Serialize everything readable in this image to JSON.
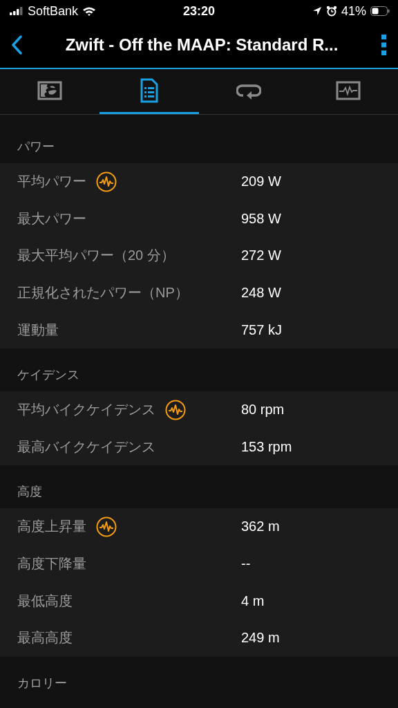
{
  "status_bar": {
    "carrier": "SoftBank",
    "time": "23:20",
    "battery": "41%"
  },
  "header": {
    "title": "Zwift - Off the MAAP: Standard R..."
  },
  "tabs": [
    {
      "kind": "map",
      "selected": false
    },
    {
      "kind": "details",
      "selected": true
    },
    {
      "kind": "laps",
      "selected": false
    },
    {
      "kind": "chart",
      "selected": false
    }
  ],
  "sections": [
    {
      "title": "パワー",
      "rows": [
        {
          "label": "平均パワー",
          "value": "209 W",
          "chart_link": true
        },
        {
          "label": "最大パワー",
          "value": "958 W",
          "chart_link": false
        },
        {
          "label": "最大平均パワー（20 分）",
          "value": "272 W",
          "chart_link": false
        },
        {
          "label": "正規化されたパワー（NP）",
          "value": "248 W",
          "chart_link": false
        },
        {
          "label": "運動量",
          "value": "757 kJ",
          "chart_link": false
        }
      ]
    },
    {
      "title": "ケイデンス",
      "rows": [
        {
          "label": "平均バイクケイデンス",
          "value": "80 rpm",
          "chart_link": true
        },
        {
          "label": "最高バイクケイデンス",
          "value": "153 rpm",
          "chart_link": false
        }
      ]
    },
    {
      "title": "高度",
      "rows": [
        {
          "label": "高度上昇量",
          "value": "362 m",
          "chart_link": true
        },
        {
          "label": "高度下降量",
          "value": "--",
          "chart_link": false
        },
        {
          "label": "最低高度",
          "value": "4 m",
          "chart_link": false
        },
        {
          "label": "最高高度",
          "value": "249 m",
          "chart_link": false
        }
      ]
    },
    {
      "title": "カロリー"
    }
  ]
}
